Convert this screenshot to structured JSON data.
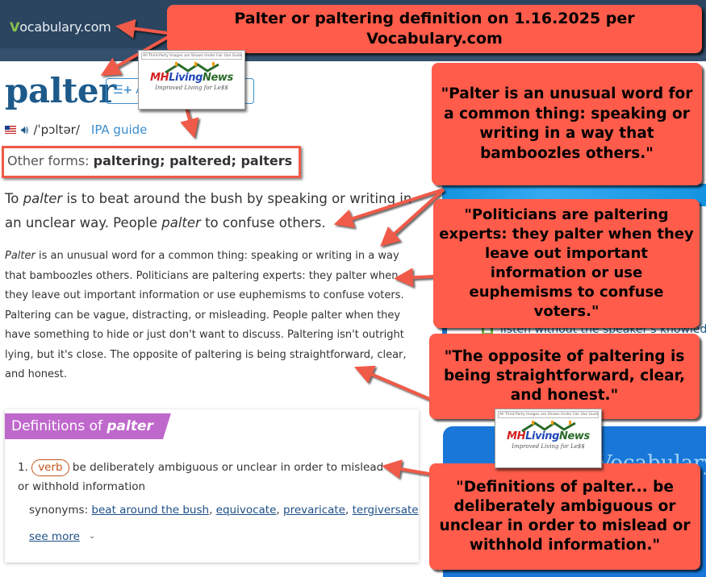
{
  "header": {
    "logo_check": "V",
    "logo_text": "ocabulary.com"
  },
  "entry": {
    "word": "palter",
    "add_to_list_label": "Add to list",
    "pronunciation": "/ˈpɔltər/",
    "ipa_guide_label": "IPA guide",
    "other_forms_label": "Other forms:",
    "other_forms_value": "paltering; paltered; palters",
    "short_def": {
      "p1": "To ",
      "i1": "palter",
      "p2": " is to beat around the bush by speaking or writing in an unclear way. People ",
      "i2": "palter",
      "p3": " to confuse others."
    },
    "long_def": {
      "i1": "Palter",
      "p1": " is an unusual word for a common thing: speaking or writing in a way that bamboozles others. Politicians are paltering experts: they palter when they leave out important information or use euphemisms to confuse voters. Paltering can be vague, distracting, or misleading. People palter when they have something to hide or just don't want to discuss. Paltering isn't outright lying, but it's close. The opposite of paltering is being straightforward, clear, and honest."
    }
  },
  "definitions": {
    "heading_prefix": "Definitions of ",
    "heading_word": "palter",
    "items": [
      {
        "number": "1.",
        "pos": "verb",
        "text": "be deliberately ambiguous or unclear in order to mislead or withhold information",
        "synonyms_label": "synonyms:",
        "synonyms": [
          "beat around the bush",
          "equivocate",
          "prevaricate",
          "tergiversate"
        ]
      }
    ],
    "see_more_label": "see more",
    "see_more_icon": "chevron-down-icon"
  },
  "sidebar_background": {
    "partial_text": "listen without the speaker's knowled",
    "card_title_partial": "Vocabulary"
  },
  "callouts": {
    "title": "Palter or paltering definition on 1.16.2025 per Vocabulary.com",
    "c1": "\"Palter is an unusual word for a common thing: speaking or writing in a way that bamboozles others.\"",
    "c2": "\"Politicians are paltering experts: they palter when they leave out important information or use euphemisms to confuse voters.\"",
    "c3": "\"The opposite of paltering is being straightforward, clear, and honest.\"",
    "c4": "\"Definitions of palter... be deliberately ambiguous or unclear in order to mislead or withhold information.\""
  },
  "badge": {
    "fair_use": "All Third-Party Images are Shown Under Fair Use Guidelines.",
    "brand_mh": "MH",
    "brand_living": "Living",
    "brand_news": "News",
    "tagline": "Improved Living for Le$$"
  },
  "colors": {
    "header_bg": "#2b4560",
    "word_blue": "#1d5a8a",
    "link_blue": "#3a8ed0",
    "callout_red": "#ff5c4b",
    "definitions_purple": "#bf68cc",
    "pos_orange": "#c4541c"
  }
}
